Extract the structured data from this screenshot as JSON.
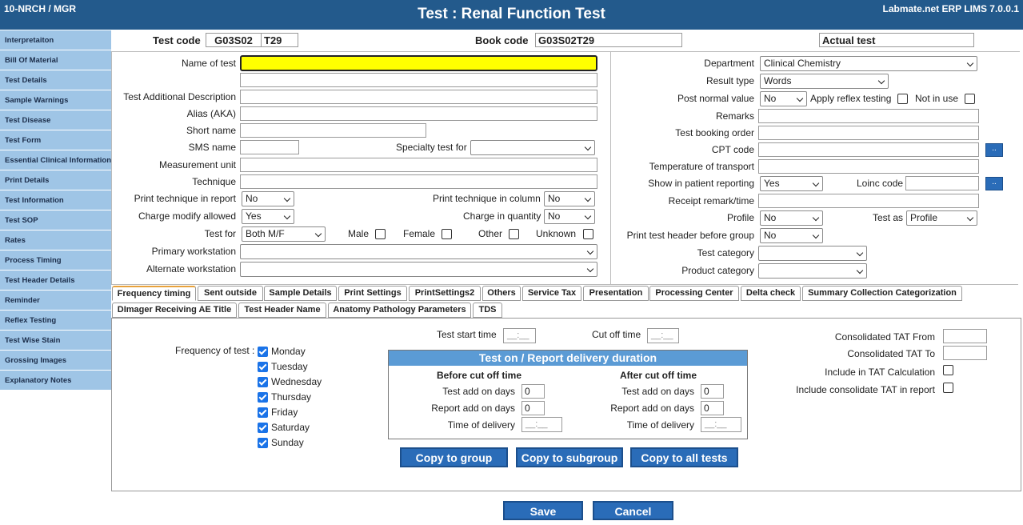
{
  "header": {
    "left": "10-NRCH / MGR",
    "title": "Test : Renal Function Test",
    "right": "Labmate.net ERP LIMS 7.0.0.1"
  },
  "sidebar": [
    "Interpretaiton",
    "Bill Of Material",
    "Test Details",
    "Sample Warnings",
    "Test Disease",
    "Test Form",
    "Essential Clinical Information",
    "Print Details",
    "Test Information",
    "Test SOP",
    "Rates",
    "Process Timing",
    "Test Header Details",
    "Reminder",
    "Reflex Testing",
    "Test Wise Stain",
    "Grossing Images",
    "Explanatory Notes"
  ],
  "top": {
    "test_code_label": "Test code",
    "test_code_1": "G03S02",
    "test_code_2": "T29",
    "book_code_label": "Book code",
    "book_code": "G03S02T29",
    "actual_test": "Actual test"
  },
  "left": {
    "name_label": "Name of test",
    "name_value": "",
    "addl_label": "Test Additional Description",
    "alias_label": "Alias (AKA)",
    "short_label": "Short name",
    "sms_label": "SMS name",
    "specialty_label": "Specialty test for",
    "unit_label": "Measurement unit",
    "technique_label": "Technique",
    "print_tech_label": "Print technique in report",
    "print_tech_value": "No",
    "print_tech_col_label": "Print technique in column",
    "print_tech_col_value": "No",
    "charge_modify_label": "Charge modify allowed",
    "charge_modify_value": "Yes",
    "charge_qty_label": "Charge in quantity",
    "charge_qty_value": "No",
    "test_for_label": "Test for",
    "test_for_value": "Both M/F",
    "male": "Male",
    "female": "Female",
    "other": "Other",
    "unknown": "Unknown",
    "primary_label": "Primary workstation",
    "alternate_label": "Alternate workstation"
  },
  "right": {
    "dept_label": "Department",
    "dept_value": "Clinical Chemistry",
    "result_type_label": "Result type",
    "result_type_value": "Words",
    "post_normal_label": "Post normal value",
    "post_normal_value": "No",
    "apply_reflex": "Apply reflex testing",
    "not_in_use": "Not in use",
    "remarks_label": "Remarks",
    "booking_order_label": "Test booking order",
    "cpt_label": "CPT code",
    "dots": "..",
    "temperature_label": "Temperature of transport",
    "show_patient_label": "Show in patient reporting",
    "show_patient_value": "Yes",
    "loinc_label": "Loinc code",
    "receipt_label": "Receipt remark/time",
    "profile_label": "Profile",
    "profile_value": "No",
    "test_as_label": "Test as",
    "test_as_value": "Profile",
    "print_header_label": "Print test header before group",
    "print_header_value": "No",
    "test_category_label": "Test category",
    "product_category_label": "Product category"
  },
  "tabs_row1": [
    "Frequency timing",
    "Sent outside",
    "Sample Details",
    "Print Settings",
    "PrintSettings2",
    "Others",
    "Service Tax",
    "Presentation",
    "Processing Center",
    "Delta check",
    "Summary Collection Categorization"
  ],
  "tabs_row2": [
    "DImager Receiving AE Title",
    "Test Header Name",
    "Anatomy Pathology Parameters",
    "TDS"
  ],
  "freq": {
    "label": "Frequency of test :",
    "days": [
      "Monday",
      "Tuesday",
      "Wednesday",
      "Thursday",
      "Friday",
      "Saturday",
      "Sunday"
    ],
    "start_label": "Test start time",
    "cutoff_label": "Cut off time",
    "time_placeholder": "__:__",
    "box_title": "Test on / Report delivery duration",
    "before": "Before cut off time",
    "after": "After cut off time",
    "test_add": "Test add on days",
    "report_add": "Report add on days",
    "time_delivery": "Time of delivery",
    "before_test_add": "0",
    "before_report_add": "0",
    "after_test_add": "0",
    "after_report_add": "0",
    "tat_from": "Consolidated TAT From",
    "tat_to": "Consolidated TAT To",
    "include_tat": "Include in TAT Calculation",
    "include_consolidate": "Include consolidate TAT in report",
    "copy_group": "Copy to group",
    "copy_subgroup": "Copy to subgroup",
    "copy_all": "Copy to all tests"
  },
  "actions": {
    "save": "Save",
    "cancel": "Cancel"
  },
  "colors": {
    "header": "#235a8c",
    "sidebar": "#9fc5e6",
    "button": "#2a6cb8",
    "name_highlight": "#ffff00"
  }
}
